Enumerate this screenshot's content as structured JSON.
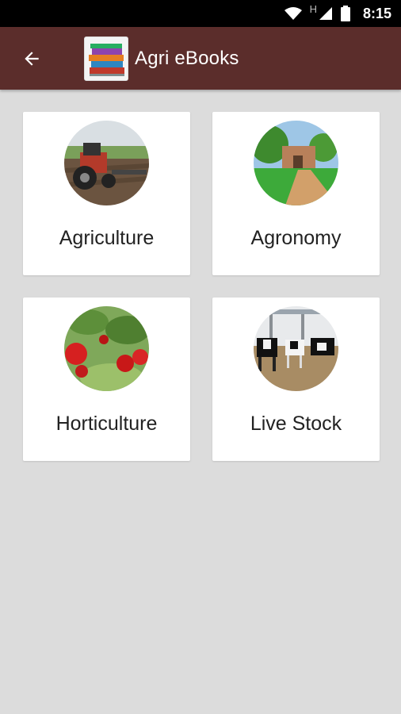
{
  "status_bar": {
    "time": "8:15",
    "network_label": "H",
    "icons": [
      "wifi-icon",
      "signal-icon",
      "battery-icon"
    ]
  },
  "app_bar": {
    "title": "Agri eBooks",
    "back_icon": "arrow-back-icon",
    "background_color": "#5b2d2b"
  },
  "categories": [
    {
      "label": "Agriculture",
      "image": "tractor-field-photo"
    },
    {
      "label": "Agronomy",
      "image": "farm-path-photo"
    },
    {
      "label": "Horticulture",
      "image": "apples-tree-photo"
    },
    {
      "label": "Live Stock",
      "image": "cows-barn-photo"
    }
  ],
  "colors": {
    "background": "#dcdcdc",
    "card": "#ffffff"
  }
}
